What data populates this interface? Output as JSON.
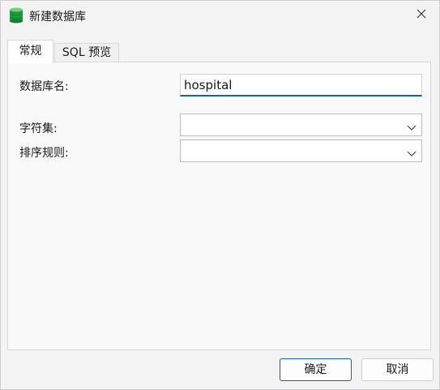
{
  "window": {
    "title": "新建数据库",
    "icon": "database-icon",
    "close_icon": "close-icon"
  },
  "tabs": [
    {
      "label": "常规",
      "active": true
    },
    {
      "label": "SQL 预览",
      "active": false
    }
  ],
  "form": {
    "db_name_label": "数据库名:",
    "db_name_value": "hospital",
    "charset_label": "字符集:",
    "charset_value": "",
    "collation_label": "排序规则:",
    "collation_value": ""
  },
  "buttons": {
    "ok": "确定",
    "cancel": "取消"
  },
  "colors": {
    "accent": "#1a5fa8",
    "icon_green": "#1f9a3d"
  }
}
